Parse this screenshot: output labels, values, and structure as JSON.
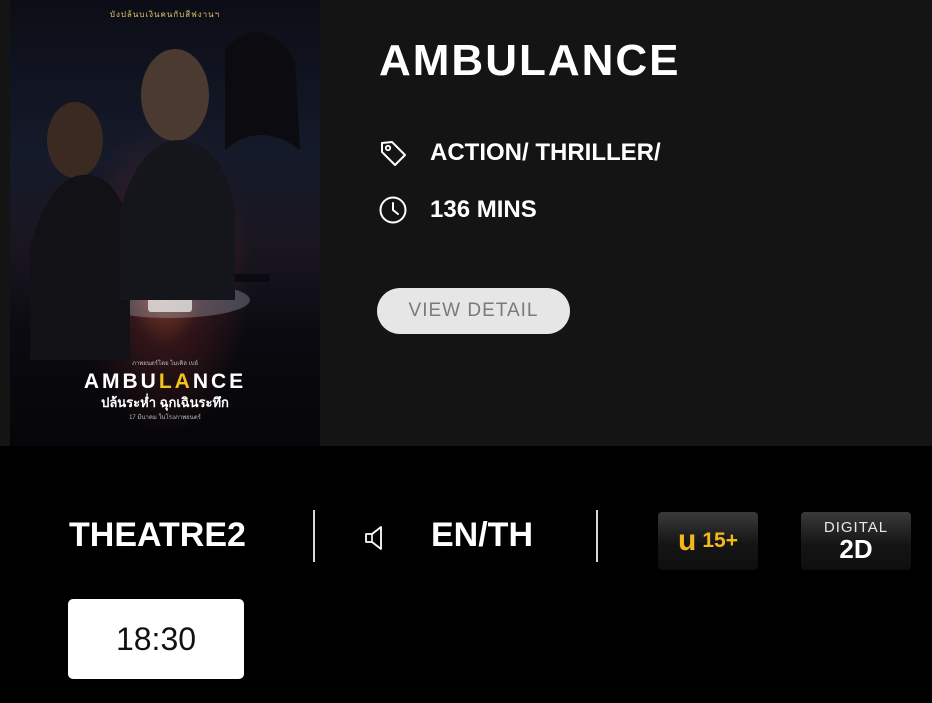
{
  "movie": {
    "title": "AMBULANCE",
    "genre": "ACTION/ THRILLER/",
    "duration": "136 MINS",
    "view_detail_label": "VIEW DETAIL"
  },
  "poster": {
    "tagline": "บังปล้นบเงินคนกับสีฟงานฯ",
    "title_part1": "AMBU",
    "title_highlight": "LA",
    "title_part2": "NCE",
    "subtitle_th": "ปล้นระห่ำ ฉุกเฉินระทึก",
    "release_line": "17 มีนาคม ในโรงภาพยนตร์",
    "credit_line": "ภาพยนตร์โดย ไมเคิล เบย์"
  },
  "screening": {
    "theatre": "THEATRE2",
    "language": "EN/TH",
    "rating_letter": "u",
    "rating_age": "15+",
    "format_top": "DIGITAL",
    "format_bottom": "2D"
  },
  "showtimes": [
    "18:30"
  ],
  "colors": {
    "panel_bg": "#141414",
    "page_bg": "#000000",
    "rating_accent": "#f2b81c",
    "poster_title_highlight": "#f4c319"
  },
  "icons": {
    "genre": "tag-icon",
    "duration": "clock-icon",
    "audio": "speaker-icon"
  }
}
